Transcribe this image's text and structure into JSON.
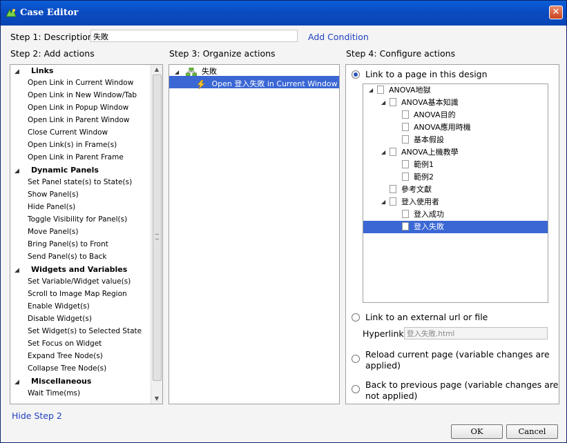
{
  "window": {
    "title": "Case Editor",
    "close_label": "✕"
  },
  "step1": {
    "label": "Step 1: Description",
    "value": "失敗",
    "add_condition": "Add Condition"
  },
  "step2": {
    "label": "Step 2: Add actions",
    "groups": [
      {
        "name": "Links",
        "items": [
          "Open Link in Current Window",
          "Open Link in New Window/Tab",
          "Open Link in Popup Window",
          "Open Link in Parent Window",
          "Close Current Window",
          "Open Link(s) in Frame(s)",
          "Open Link in Parent Frame"
        ]
      },
      {
        "name": "Dynamic Panels",
        "items": [
          "Set Panel state(s) to State(s)",
          "Show Panel(s)",
          "Hide Panel(s)",
          "Toggle Visibility for Panel(s)",
          "Move Panel(s)",
          "Bring Panel(s) to Front",
          "Send Panel(s) to Back"
        ]
      },
      {
        "name": "Widgets and Variables",
        "items": [
          "Set Variable/Widget value(s)",
          "Scroll to Image Map Region",
          "Enable Widget(s)",
          "Disable Widget(s)",
          "Set Widget(s) to Selected State",
          "Set Focus on Widget",
          "Expand Tree Node(s)",
          "Collapse Tree Node(s)"
        ]
      },
      {
        "name": "Miscellaneous",
        "items": [
          "Wait Time(ms)"
        ]
      }
    ]
  },
  "step3": {
    "label": "Step 3: Organize actions",
    "case_name": "失敗",
    "action": "Open 登入失敗 in Current Window"
  },
  "step4": {
    "label": "Step 4: Configure actions",
    "opt_link_page": "Link to a page in this design",
    "tree": [
      {
        "label": "ANOVA地獄",
        "level": 0,
        "expanded": true
      },
      {
        "label": "ANOVA基本知識",
        "level": 1,
        "expanded": true
      },
      {
        "label": "ANOVA目的",
        "level": 2
      },
      {
        "label": "ANOVA應用時機",
        "level": 2
      },
      {
        "label": "基本假設",
        "level": 2
      },
      {
        "label": "ANOVA上機教學",
        "level": 1,
        "expanded": true
      },
      {
        "label": "範例1",
        "level": 2
      },
      {
        "label": "範例2",
        "level": 2
      },
      {
        "label": "參考文獻",
        "level": 1
      },
      {
        "label": "登入使用者",
        "level": 1,
        "expanded": true
      },
      {
        "label": "登入成功",
        "level": 2
      },
      {
        "label": "登入失敗",
        "level": 2,
        "selected": true
      }
    ],
    "opt_external": "Link to an external url or file",
    "hyperlink_label": "Hyperlink",
    "hyperlink_value": "登入失敗.html",
    "opt_reload_1": "Reload current page (variable changes are",
    "opt_reload_2": "applied)",
    "opt_back_1": "Back to previous page (variable changes are",
    "opt_back_2": "not applied)"
  },
  "footer": {
    "hide_step2": "Hide Step 2",
    "ok": "OK",
    "cancel": "Cancel"
  },
  "colors": {
    "selection": "#3a67d4",
    "link": "#1f3fbf",
    "title_bar": "#0b4bc2"
  }
}
